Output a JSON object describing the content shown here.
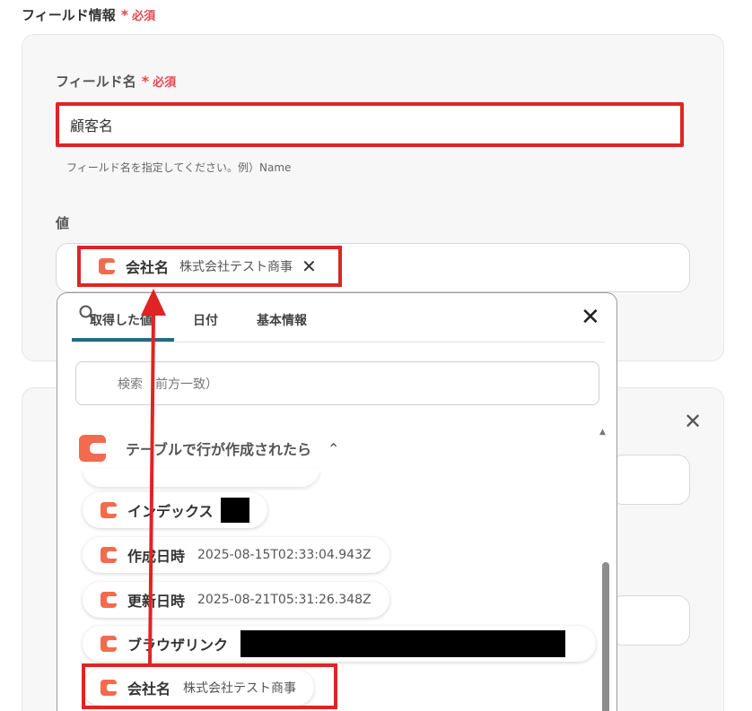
{
  "section": {
    "title": "フィールド情報",
    "star": "*",
    "required": "必須"
  },
  "field_name": {
    "label": "フィールド名",
    "star": "*",
    "required": "必須",
    "value": "顧客名",
    "hint": "フィールド名を指定してください。例）Name"
  },
  "value_field": {
    "label": "値",
    "pill": {
      "label": "会社名",
      "value": "株式会社テスト商事",
      "close": "✕"
    }
  },
  "dropdown": {
    "tabs": [
      "取得した値",
      "日付",
      "基本情報"
    ],
    "close": "✕",
    "search_placeholder": "検索（前方一致）",
    "group": {
      "label": "テーブルで行が作成されたら",
      "chevron": "⌃"
    },
    "items": [
      {
        "label": "インデックス",
        "value": ""
      },
      {
        "label": "作成日時",
        "value": "2025-08-15T02:33:04.943Z"
      },
      {
        "label": "更新日時",
        "value": "2025-08-21T05:31:26.348Z"
      },
      {
        "label": "ブラウザリンク",
        "value": ""
      },
      {
        "label": "会社名",
        "value": "株式会社テスト商事"
      }
    ],
    "scroll_up": "▲"
  },
  "card2": {
    "close": "✕"
  },
  "colors": {
    "accent_red": "#e02424",
    "brand_orange": "#f26b4f",
    "tab_underline": "#1f6f84"
  }
}
